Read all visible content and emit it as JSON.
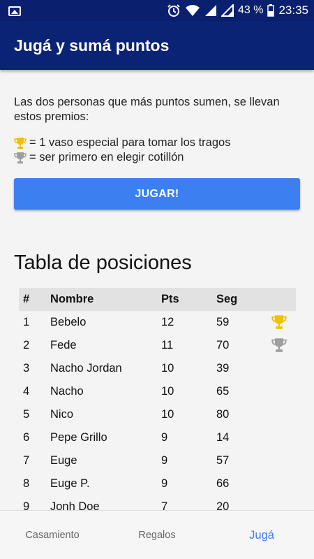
{
  "status_bar": {
    "battery": "43 %",
    "time": "23:35",
    "icons": [
      "image-icon",
      "alarm-icon",
      "wifi-icon",
      "signal-icon",
      "battery-icon"
    ]
  },
  "app_bar": {
    "title": "Jugá y sumá puntos"
  },
  "intro": {
    "text": "Las dos personas que más puntos sumen, se llevan estos premios:",
    "prizes": [
      {
        "icon": "gold-trophy-icon",
        "text": "= 1 vaso especial para tomar los tragos"
      },
      {
        "icon": "silver-trophy-icon",
        "text": "= ser primero en elegir cotillón"
      }
    ]
  },
  "play_button": {
    "label": "JUGAR!"
  },
  "leaderboard": {
    "title": "Tabla de posiciones",
    "columns": [
      "#",
      "Nombre",
      "Pts",
      "Seg"
    ],
    "rows": [
      {
        "pos": "1",
        "name": "Bebelo",
        "pts": "12",
        "seg": "59",
        "trophy": "gold"
      },
      {
        "pos": "2",
        "name": "Fede",
        "pts": "11",
        "seg": "70",
        "trophy": "silver"
      },
      {
        "pos": "3",
        "name": "Nacho Jordan",
        "pts": "10",
        "seg": "39",
        "trophy": ""
      },
      {
        "pos": "4",
        "name": "Nacho",
        "pts": "10",
        "seg": "65",
        "trophy": ""
      },
      {
        "pos": "5",
        "name": "Nico",
        "pts": "10",
        "seg": "80",
        "trophy": ""
      },
      {
        "pos": "6",
        "name": "Pepe Grillo",
        "pts": "9",
        "seg": "14",
        "trophy": ""
      },
      {
        "pos": "7",
        "name": "Euge",
        "pts": "9",
        "seg": "57",
        "trophy": ""
      },
      {
        "pos": "8",
        "name": "Euge P.",
        "pts": "9",
        "seg": "66",
        "trophy": ""
      },
      {
        "pos": "9",
        "name": "Jonh Doe",
        "pts": "7",
        "seg": "20",
        "trophy": ""
      }
    ]
  },
  "bottom_nav": {
    "items": [
      {
        "label": "Casamiento",
        "active": false
      },
      {
        "label": "Regalos",
        "active": false
      },
      {
        "label": "Jugá",
        "active": true
      }
    ]
  },
  "colors": {
    "status_bar": "#0a1f6e",
    "app_bar": "#0b2374",
    "accent": "#3b7ff0",
    "gold": "#f2c200",
    "silver": "#9e9e9e"
  }
}
